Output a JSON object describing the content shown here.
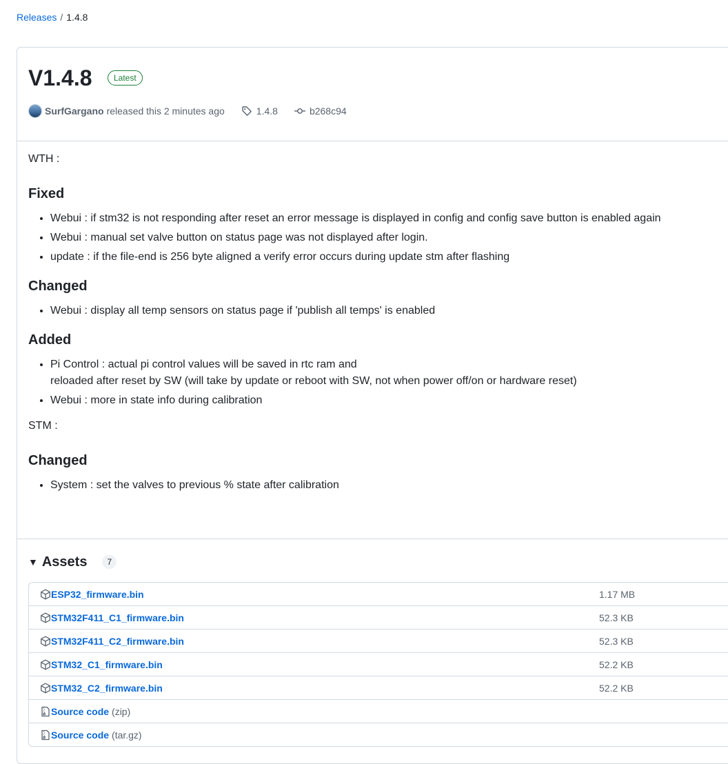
{
  "breadcrumb": {
    "releases_label": "Releases",
    "separator": "/",
    "current": "1.4.8"
  },
  "release": {
    "title": "V1.4.8",
    "badge": "Latest",
    "author": "SurfGargano",
    "released_text": "released this 2 minutes ago",
    "tag": "1.4.8",
    "commit": "b268c94"
  },
  "notes": {
    "wth_label": "WTH :",
    "fixed_heading": "Fixed",
    "fixed_items": [
      "Webui : if stm32 is not responding after reset an error message is displayed in config and config save button is enabled again",
      "Webui : manual set valve button on status page was not displayed after login.",
      "update : if the file-end is 256 byte aligned a verify error occurs during update stm after flashing"
    ],
    "changed_heading": "Changed",
    "changed_items": [
      "Webui : display all temp sensors on status page if 'publish all temps' is enabled"
    ],
    "added_heading": "Added",
    "added_item1_line1": "Pi Control : actual pi control values will be saved in rtc ram and",
    "added_item1_line2": "reloaded after reset by SW (will take by update or reboot with SW, not when power off/on or hardware reset)",
    "added_item2": "Webui : more in state info during calibration",
    "stm_label": "STM :",
    "stm_changed_heading": "Changed",
    "stm_changed_items": [
      "System : set the valves to previous % state after calibration"
    ]
  },
  "assets": {
    "heading": "Assets",
    "count": "7",
    "items": [
      {
        "name": "ESP32_firmware.bin",
        "suffix": "",
        "size": "1.17 MB",
        "icon": "package-icon"
      },
      {
        "name": "STM32F411_C1_firmware.bin",
        "suffix": "",
        "size": "52.3 KB",
        "icon": "package-icon"
      },
      {
        "name": "STM32F411_C2_firmware.bin",
        "suffix": "",
        "size": "52.3 KB",
        "icon": "package-icon"
      },
      {
        "name": "STM32_C1_firmware.bin",
        "suffix": "",
        "size": "52.2 KB",
        "icon": "package-icon"
      },
      {
        "name": "STM32_C2_firmware.bin",
        "suffix": "",
        "size": "52.2 KB",
        "icon": "package-icon"
      },
      {
        "name": "Source code",
        "suffix": "(zip)",
        "size": "",
        "icon": "file-zip-icon"
      },
      {
        "name": "Source code",
        "suffix": "(tar.gz)",
        "size": "",
        "icon": "file-zip-icon"
      }
    ]
  },
  "colors": {
    "link": "#0969da",
    "latest_badge": "#1a7f37",
    "muted": "#59636e",
    "border": "#d1d9e0"
  }
}
